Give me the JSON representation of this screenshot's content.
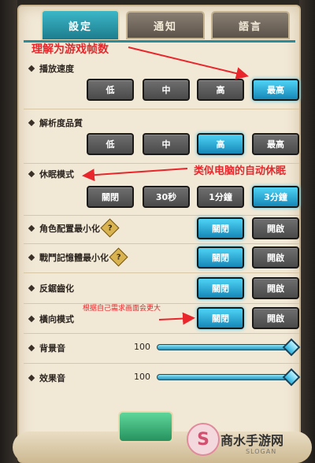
{
  "tabs": [
    {
      "label": "設定"
    },
    {
      "label": "通知"
    },
    {
      "label": "語言"
    }
  ],
  "settings": {
    "playback": {
      "label": "播放速度",
      "options": [
        "低",
        "中",
        "高",
        "最高"
      ],
      "selected": 3
    },
    "resolution": {
      "label": "解析度品質",
      "options": [
        "低",
        "中",
        "高",
        "最高"
      ],
      "selected": 2
    },
    "sleep": {
      "label": "休眠模式",
      "options": [
        "關閉",
        "30秒",
        "1分鐘",
        "3分鐘"
      ],
      "selected": 3
    },
    "minimize_char": {
      "label": "角色配置最小化",
      "help": "?",
      "options": [
        "關閉",
        "開啟"
      ],
      "selected": 0
    },
    "minimize_battle": {
      "label": "戰鬥記憶體最小化",
      "help": "?",
      "options": [
        "關閉",
        "開啟"
      ],
      "selected": 0
    },
    "antialias": {
      "label": "反鋸齒化",
      "options": [
        "關閉",
        "開啟"
      ],
      "selected": 0
    },
    "landscape": {
      "label": "橫向模式",
      "options": [
        "關閉",
        "開啟"
      ],
      "selected": 0
    },
    "bgm": {
      "label": "背景音",
      "value_text": "100",
      "value": 100
    },
    "sfx": {
      "label": "效果音",
      "value_text": "100",
      "value": 100
    }
  },
  "annotations": {
    "a1": "理解为游戏帧数",
    "a2": "类似电脑的自动休眠",
    "a3": "根据自己需求画面会更大"
  },
  "watermark": {
    "text": "商水手游网",
    "sub": "SLOGAN",
    "logo": "S"
  },
  "colors": {
    "active": "#1587b8",
    "annotation": "#e8262b",
    "tab_active": "#1d7c8d"
  }
}
